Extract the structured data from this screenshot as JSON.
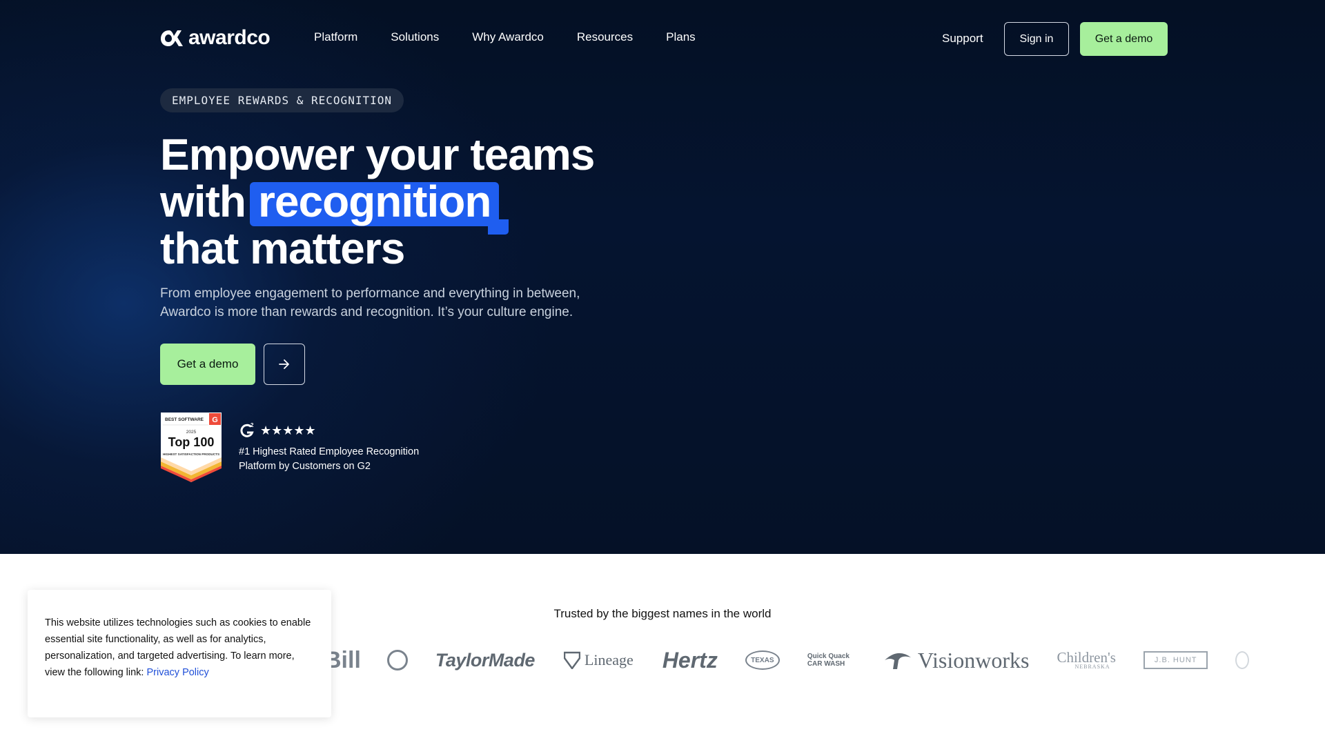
{
  "brand": {
    "name": "awardco"
  },
  "nav": {
    "items": [
      "Platform",
      "Solutions",
      "Why Awardco",
      "Resources",
      "Plans"
    ],
    "support": "Support",
    "sign_in": "Sign in",
    "get_demo": "Get a demo"
  },
  "hero": {
    "eyebrow": "EMPLOYEE REWARDS & RECOGNITION",
    "headline_line1": "Empower your teams",
    "headline_line2_prefix": "with",
    "headline_highlight": "recognition",
    "headline_line3": "that matters",
    "subtext": "From employee engagement to performance and everything in between, Awardco is more than rewards and recognition. It’s your culture engine.",
    "cta_demo": "Get a demo",
    "cta_arrow_icon": "arrow-right-icon"
  },
  "badge": {
    "line1": "BEST SOFTWARE",
    "year": "2025",
    "title": "Top 100",
    "caption": "HIGHEST SATISFACTION PRODUCTS",
    "stars": "★★★★★",
    "rating_text": "#1 Highest Rated Employee Recognition Platform by Customers on G2"
  },
  "trusted": {
    "heading": "Trusted by the biggest names in the world",
    "logos": [
      "Bill",
      "TaylorMade",
      "Lineage",
      "Hertz",
      "TEXAS",
      "Quick Quack CAR WASH",
      "Visionworks",
      "Children's",
      "NEBRASKA",
      "J.B. HUNT"
    ]
  },
  "cookie": {
    "text": "This website utilizes technologies such as cookies to enable essential site functionality, as well as for analytics, personalization, and targeted advertising. To learn more, view the following link: ",
    "link": "Privacy Policy"
  },
  "colors": {
    "accent_green": "#a7ef9c",
    "highlight_blue": "#1f5ef0",
    "hero_bg": "#051430"
  }
}
